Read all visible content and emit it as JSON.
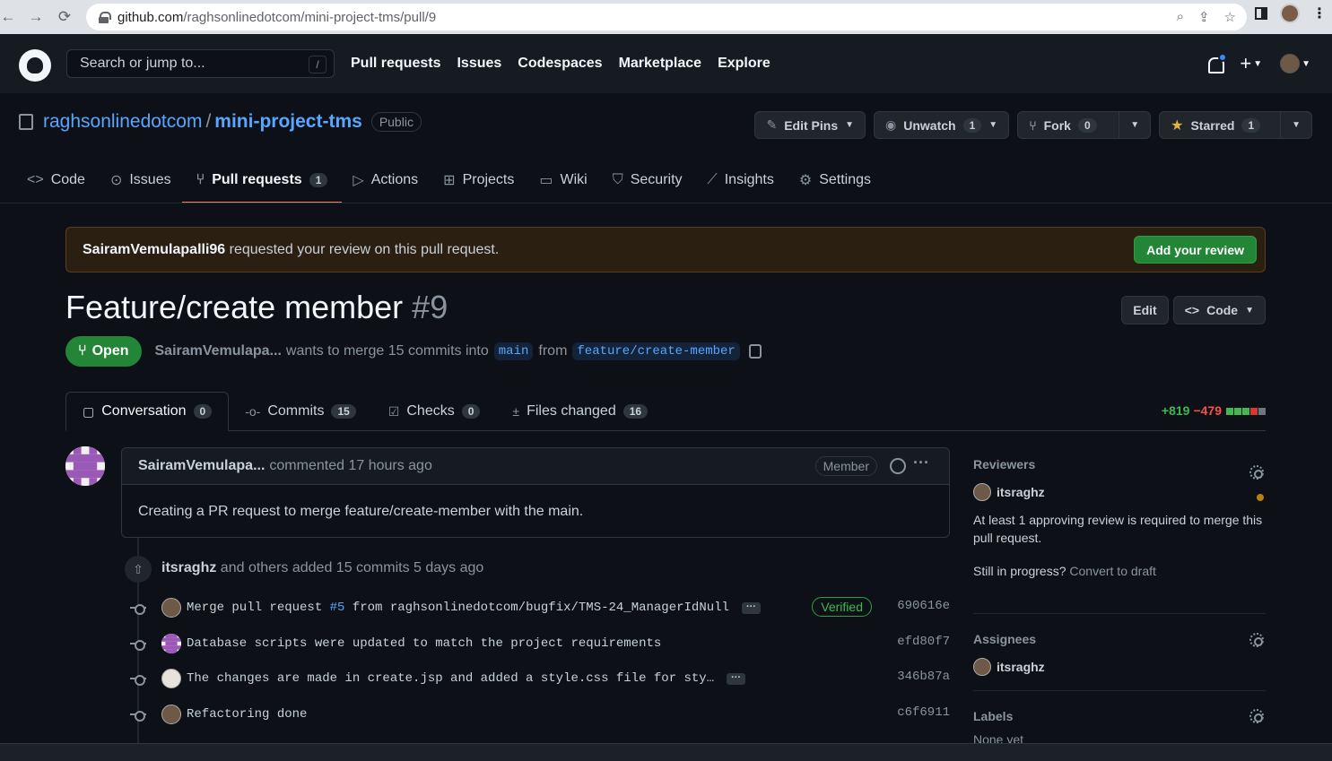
{
  "browser": {
    "url_host": "github.com",
    "url_path": "/raghsonlinedotcom/mini-project-tms/pull/9"
  },
  "header": {
    "search_placeholder": "Search or jump to...",
    "search_shortcut": "/",
    "nav": [
      "Pull requests",
      "Issues",
      "Codespaces",
      "Marketplace",
      "Explore"
    ]
  },
  "repo": {
    "owner": "raghsonlinedotcom",
    "separator": "/",
    "name": "mini-project-tms",
    "visibility": "Public",
    "actions": {
      "edit_pins": "Edit Pins",
      "unwatch": "Unwatch",
      "unwatch_count": "1",
      "fork": "Fork",
      "fork_count": "0",
      "starred": "Starred",
      "star_count": "1"
    },
    "tabs": [
      {
        "label": "Code",
        "icon": "code-icon"
      },
      {
        "label": "Issues",
        "icon": "issue-icon"
      },
      {
        "label": "Pull requests",
        "icon": "pull-request-icon",
        "count": "1",
        "active": true
      },
      {
        "label": "Actions",
        "icon": "play-icon"
      },
      {
        "label": "Projects",
        "icon": "table-icon"
      },
      {
        "label": "Wiki",
        "icon": "book-icon"
      },
      {
        "label": "Security",
        "icon": "shield-icon"
      },
      {
        "label": "Insights",
        "icon": "graph-icon"
      },
      {
        "label": "Settings",
        "icon": "gear-icon"
      }
    ]
  },
  "review_banner": {
    "requester": "SairamVemulapalli96",
    "text": "requested your review on this pull request.",
    "button": "Add your review"
  },
  "pr": {
    "title": "Feature/create member",
    "number": "#9",
    "edit_label": "Edit",
    "code_label": "Code",
    "state": "Open",
    "author": "SairamVemulapa...",
    "merge_text": "wants to merge 15 commits into",
    "base_branch": "main",
    "from_text": "from",
    "head_branch": "feature/create-member",
    "tabs": [
      {
        "label": "Conversation",
        "count": "0",
        "active": true,
        "icon": "comment-icon"
      },
      {
        "label": "Commits",
        "count": "15",
        "icon": "commit-icon"
      },
      {
        "label": "Checks",
        "count": "0",
        "icon": "checklist-icon"
      },
      {
        "label": "Files changed",
        "count": "16",
        "icon": "file-diff-icon"
      }
    ],
    "additions": "+819",
    "deletions": "−479",
    "diff_blocks": [
      "add",
      "add",
      "add",
      "del",
      "neutral"
    ],
    "colors": {
      "add": "#3fb950",
      "del": "#da3633",
      "neutral": "#6e7681"
    }
  },
  "comment": {
    "author": "SairamVemulapa...",
    "meta": "commented 17 hours ago",
    "badge": "Member",
    "body": "Creating a PR request to merge feature/create-member with the main."
  },
  "commits_event": {
    "actor": "itsraghz",
    "text": "and others added 15 commits 5 days ago"
  },
  "commits": [
    {
      "msg_pre": "Merge pull request ",
      "link": "#5",
      "msg_post": " from raghsonlinedotcom/bugfix/TMS-24_ManagerIdNull",
      "ellipsis": "···",
      "verified": "Verified",
      "sha": "690616e",
      "avatar": "photo"
    },
    {
      "msg_pre": "Database scripts were updated to match the project requirements",
      "link": "",
      "msg_post": "",
      "ellipsis": "",
      "verified": "",
      "sha": "efd80f7",
      "avatar": "purple"
    },
    {
      "msg_pre": "The changes are made in create.jsp and added a style.css file for sty…",
      "link": "",
      "msg_post": "",
      "ellipsis": "···",
      "verified": "",
      "sha": "346b87a",
      "avatar": "light"
    },
    {
      "msg_pre": "Refactoring done",
      "link": "",
      "msg_post": "",
      "ellipsis": "",
      "verified": "",
      "sha": "c6f6911",
      "avatar": "photo"
    }
  ],
  "sidebar": {
    "reviewers_title": "Reviewers",
    "reviewer": "itsraghz",
    "approval_note": "At least 1 approving review is required to merge this pull request.",
    "draft_q": "Still in progress?",
    "draft_link": "Convert to draft",
    "assignees_title": "Assignees",
    "assignee": "itsraghz",
    "labels_title": "Labels",
    "labels_value": "None yet"
  }
}
